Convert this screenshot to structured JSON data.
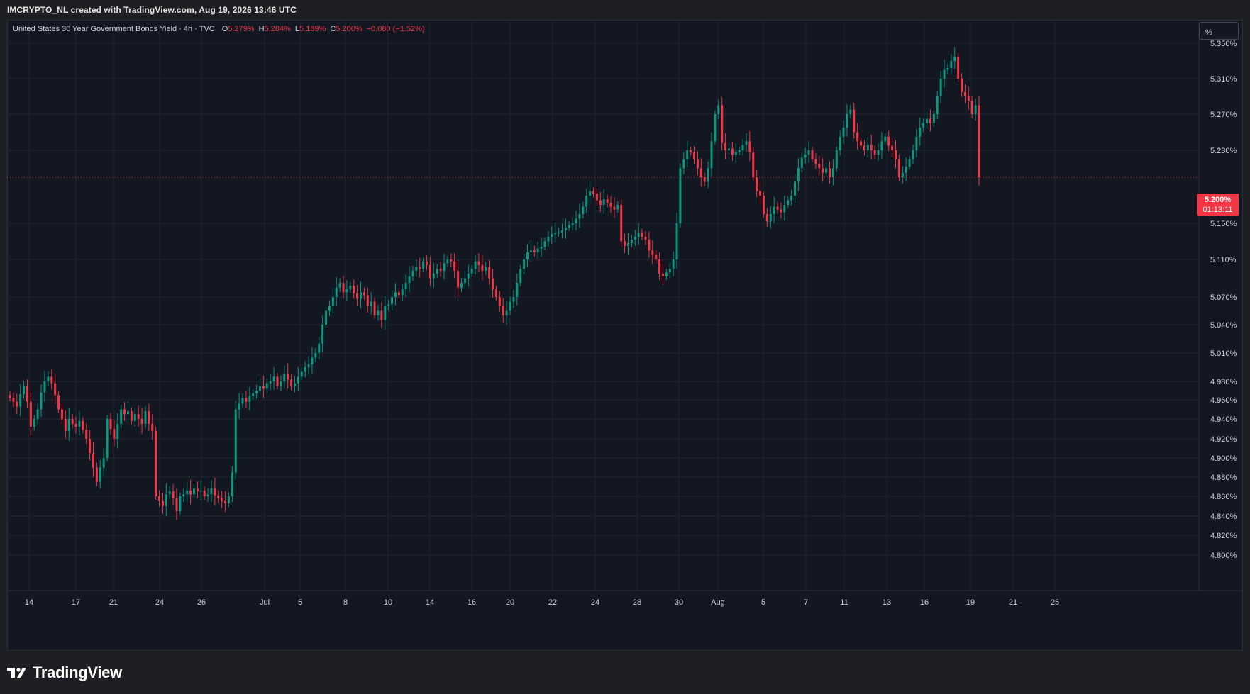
{
  "header": {
    "credit": "IMCRYPTO_NL created with TradingView.com, Aug 19, 2026 13:46 UTC"
  },
  "legend": {
    "symbol": "United States 30 Year Government Bonds Yield · 4h · TVC",
    "open_key": "O",
    "open": "5.279%",
    "high_key": "H",
    "high": "5.284%",
    "low_key": "L",
    "low": "5.189%",
    "close_key": "C",
    "close": "5.200%",
    "change": "−0.080 (−1.52%)"
  },
  "scale_button": "%",
  "last_price": {
    "price": "5.200%",
    "countdown": "01:13:11"
  },
  "brand": {
    "name": "TradingView"
  },
  "colors": {
    "background": "#131722",
    "up": "#089981",
    "down": "#f23645",
    "grid": "#1f2430",
    "axis_text": "#d1d4dc"
  },
  "chart_data": {
    "type": "candlestick",
    "interval": "4h",
    "y_unit": "%",
    "y_axis_labels": [
      "5.350%",
      "5.310%",
      "5.270%",
      "5.230%",
      "5.150%",
      "5.110%",
      "5.070%",
      "5.040%",
      "5.010%",
      "4.980%",
      "4.960%",
      "4.940%",
      "4.920%",
      "4.900%",
      "4.880%",
      "4.860%",
      "4.840%",
      "4.820%",
      "4.800%"
    ],
    "x_axis_labels": [
      "14",
      "17",
      "21",
      "24",
      "26",
      "Jul",
      "5",
      "8",
      "10",
      "14",
      "16",
      "20",
      "22",
      "24",
      "28",
      "30",
      "Aug",
      "5",
      "7",
      "11",
      "13",
      "16",
      "19",
      "21",
      "25"
    ],
    "ylim": [
      4.8,
      5.35
    ],
    "last_value": 5.2,
    "series": [
      {
        "name": "United States 30 Year Government Bonds Yield",
        "closes": [
          4.962,
          4.958,
          4.953,
          4.966,
          4.975,
          4.958,
          4.932,
          4.94,
          4.95,
          4.968,
          4.98,
          4.985,
          4.978,
          4.965,
          4.95,
          4.94,
          4.928,
          4.94,
          4.935,
          4.932,
          4.938,
          4.929,
          4.92,
          4.905,
          4.89,
          4.875,
          4.89,
          4.9,
          4.94,
          4.93,
          4.92,
          4.935,
          4.95,
          4.945,
          4.948,
          4.938,
          4.945,
          4.94,
          4.935,
          4.948,
          4.935,
          4.928,
          4.86,
          4.855,
          4.85,
          4.862,
          4.865,
          4.858,
          4.845,
          4.86,
          4.862,
          4.866,
          4.862,
          4.868,
          4.865,
          4.866,
          4.86,
          4.862,
          4.868,
          4.861,
          4.858,
          4.855,
          4.853,
          4.86,
          4.885,
          4.95,
          4.956,
          4.962,
          4.958,
          4.964,
          4.967,
          4.97,
          4.975,
          4.972,
          4.978,
          4.98,
          4.985,
          4.975,
          4.98,
          4.988,
          4.982,
          4.975,
          4.978,
          4.985,
          4.99,
          4.995,
          4.998,
          5.005,
          5.01,
          5.02,
          5.04,
          5.055,
          5.06,
          5.07,
          5.08,
          5.085,
          5.075,
          5.078,
          5.082,
          5.074,
          5.068,
          5.075,
          5.072,
          5.06,
          5.065,
          5.05,
          5.055,
          5.045,
          5.06,
          5.062,
          5.07,
          5.075,
          5.072,
          5.078,
          5.085,
          5.092,
          5.098,
          5.102,
          5.1,
          5.108,
          5.104,
          5.09,
          5.095,
          5.1,
          5.098,
          5.106,
          5.11,
          5.108,
          5.098,
          5.08,
          5.085,
          5.09,
          5.095,
          5.1,
          5.108,
          5.104,
          5.098,
          5.102,
          5.09,
          5.078,
          5.07,
          5.06,
          5.05,
          5.055,
          5.065,
          5.07,
          5.085,
          5.1,
          5.11,
          5.118,
          5.12,
          5.118,
          5.122,
          5.124,
          5.13,
          5.135,
          5.138,
          5.14,
          5.14,
          5.142,
          5.145,
          5.148,
          5.15,
          5.155,
          5.16,
          5.168,
          5.18,
          5.185,
          5.182,
          5.175,
          5.17,
          5.176,
          5.172,
          5.168,
          5.165,
          5.17,
          5.13,
          5.125,
          5.128,
          5.132,
          5.135,
          5.14,
          5.135,
          5.132,
          5.12,
          5.115,
          5.11,
          5.095,
          5.092,
          5.096,
          5.1,
          5.11,
          5.15,
          5.21,
          5.22,
          5.23,
          5.228,
          5.22,
          5.21,
          5.2,
          5.195,
          5.21,
          5.24,
          5.27,
          5.28,
          5.238,
          5.23,
          5.232,
          5.225,
          5.228,
          5.23,
          5.236,
          5.24,
          5.228,
          5.2,
          5.185,
          5.18,
          5.16,
          5.152,
          5.16,
          5.168,
          5.165,
          5.162,
          5.17,
          5.175,
          5.18,
          5.195,
          5.21,
          5.222,
          5.225,
          5.23,
          5.22,
          5.215,
          5.21,
          5.205,
          5.21,
          5.2,
          5.21,
          5.23,
          5.245,
          5.255,
          5.27,
          5.275,
          5.25,
          5.24,
          5.235,
          5.23,
          5.236,
          5.23,
          5.225,
          5.23,
          5.24,
          5.245,
          5.235,
          5.23,
          5.22,
          5.2,
          5.205,
          5.212,
          5.22,
          5.23,
          5.245,
          5.255,
          5.26,
          5.265,
          5.26,
          5.27,
          5.29,
          5.31,
          5.32,
          5.322,
          5.33,
          5.335,
          5.31,
          5.295,
          5.29,
          5.285,
          5.27,
          5.28,
          5.2
        ]
      }
    ]
  }
}
